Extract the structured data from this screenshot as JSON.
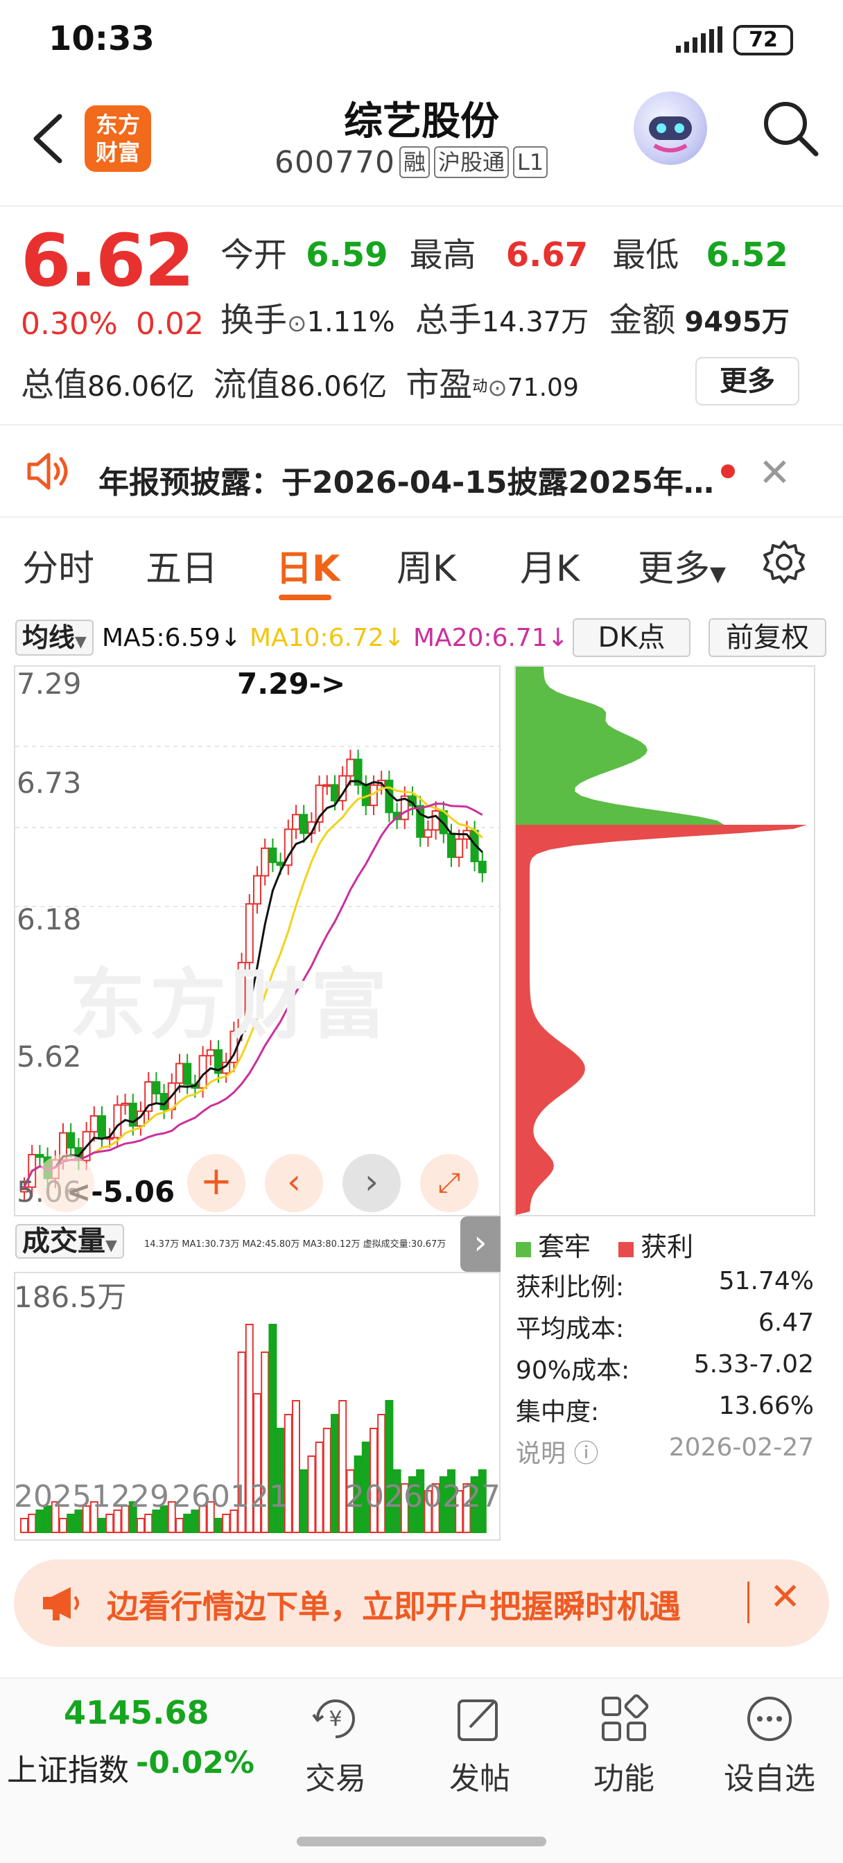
{
  "status_bar": {
    "time": "10:33",
    "battery": "72"
  },
  "header": {
    "logo_line1": "东方",
    "logo_line2": "财富",
    "name": "综艺股份",
    "code": "600770",
    "tags": [
      "融",
      "沪股通",
      "L1"
    ]
  },
  "quote": {
    "price": "6.62",
    "change_pct": "0.30%",
    "change": "0.02",
    "open_label": "今开",
    "open": "6.59",
    "high_label": "最高",
    "high": "6.67",
    "low_label": "最低",
    "low": "6.52",
    "turnover_label": "换手",
    "turnover": "1.11%",
    "volume_label": "总手",
    "volume": "14.37万",
    "amount_label": "金额",
    "amount": "9495万",
    "mktcap_label": "总值",
    "mktcap": "86.06亿",
    "float_label": "流值",
    "float_cap": "86.06亿",
    "pe_label": "市盈",
    "pe_sup": "动",
    "pe": "71.09",
    "more_label": "更多"
  },
  "notice": {
    "text": "年报预披露：于2026-04-15披露2025年…"
  },
  "tabs": [
    "分时",
    "五日",
    "日K",
    "周K",
    "月K",
    "更多"
  ],
  "ma_row": {
    "select": "均线",
    "ma5": "MA5:6.59",
    "ma10": "MA10:6.72",
    "ma20": "MA20:6.71",
    "dk_label": "DK点",
    "adjust_label": "前复权"
  },
  "kline": {
    "y_labels": [
      "7.29",
      "6.73",
      "6.18",
      "5.62",
      "5.06"
    ],
    "high_marker": "7.29->",
    "low_marker": "<-5.06",
    "watermark": "东方财富"
  },
  "volume": {
    "select": "成交量",
    "legend": "14.37万  MA1:30.73万  MA2:45.80万  MA3:80.12万  虚拟成交量:30.67万",
    "max_label": "186.5万",
    "dates": [
      "20251229",
      "20260121",
      "20260227"
    ]
  },
  "chips": {
    "legend_locked": "套牢",
    "legend_profit": "获利",
    "stats": [
      {
        "label": "获利比例:",
        "value": "51.74%"
      },
      {
        "label": "平均成本:",
        "value": "6.47"
      },
      {
        "label": "90%成本:",
        "value": "5.33-7.02"
      },
      {
        "label": "集中度:",
        "value": "13.66%"
      }
    ],
    "note_label": "说明",
    "note_date": "2026-02-27"
  },
  "ad": {
    "text": "边看行情边下单，立即开户把握瞬时机遇"
  },
  "bottom": {
    "index_value": "4145.68",
    "index_name": "上证指数",
    "index_pct": "-0.02%",
    "nav": [
      "交易",
      "发帖",
      "功能",
      "设自选"
    ]
  },
  "colors": {
    "up": "#e8312f",
    "down": "#15a51e",
    "accent": "#f06318",
    "ma5": "#111111",
    "ma10": "#f2d31a",
    "ma20": "#cc2e9c"
  }
}
